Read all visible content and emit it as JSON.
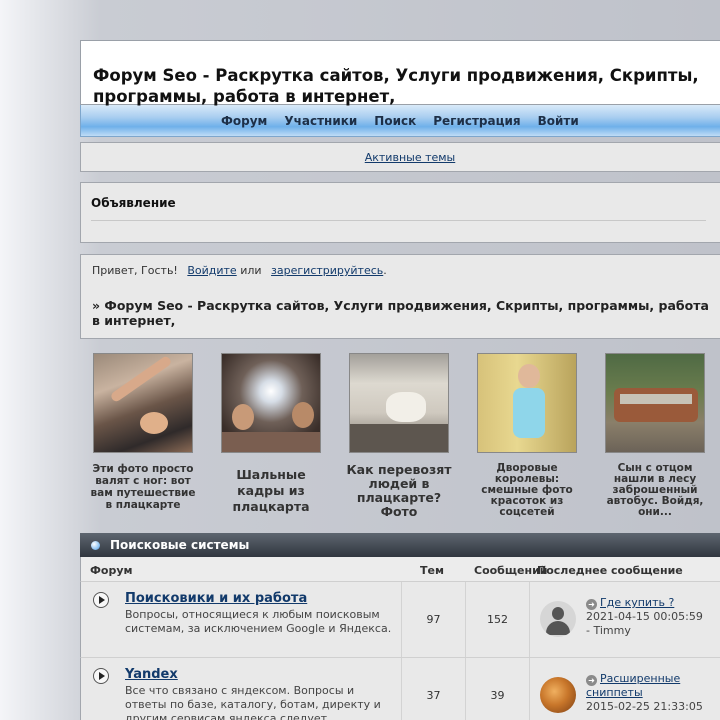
{
  "header": {
    "title": "Форум Seo - Раскрутка сайтов, Услуги продвижения, Скрипты, программы, работа в интернет,"
  },
  "nav": {
    "items": [
      "Форум",
      "Участники",
      "Поиск",
      "Регистрация",
      "Войти"
    ]
  },
  "active_topics": "Активные темы",
  "announcement": {
    "title": "Объявление"
  },
  "greeting": {
    "hello": "Привет, Гость!",
    "login": "Войдите",
    "or": "или",
    "register": "зарегистрируйтесь",
    "period": ".",
    "breadcrumb": "» Форум Seo - Раскрутка сайтов, Услуги продвижения, Скрипты, программы, работа в интернет,"
  },
  "gallery": [
    {
      "caption": "Эти фото просто валят с ног: вот вам путешествие в плацкарте"
    },
    {
      "caption": "Шальные кадры из плацкарта"
    },
    {
      "caption": "Как перевозят людей в плацкарте? Фото"
    },
    {
      "caption": "Дворовые королевы: смешные фото красоток из соцсетей"
    },
    {
      "caption": "Сын с отцом нашли в лесу заброшенный автобус. Войдя, они..."
    }
  ],
  "forum": {
    "category": "Поисковые системы",
    "columns": {
      "forum": "Форум",
      "topics": "Тем",
      "posts": "Сообщений",
      "last": "Последнее сообщение"
    },
    "rows": [
      {
        "title": "Поисковики и их работа",
        "desc": "Вопросы, относящиеся к любым поисковым системам, за исключением Google и Яндекса.",
        "topics": "97",
        "posts": "152",
        "last_title": "Где купить ?",
        "last_date": "2021-04-15 00:05:59",
        "last_author": "- Timmy"
      },
      {
        "title": "Yandex",
        "desc": "Все что связано с яндексом. Вопросы и ответы по базе, каталогу, ботам, директу и другим сервисам яндекса следует",
        "topics": "37",
        "posts": "39",
        "last_title": "Расширенные сниппеты",
        "last_date": "2015-02-25 21:33:05",
        "last_author": ""
      }
    ]
  }
}
